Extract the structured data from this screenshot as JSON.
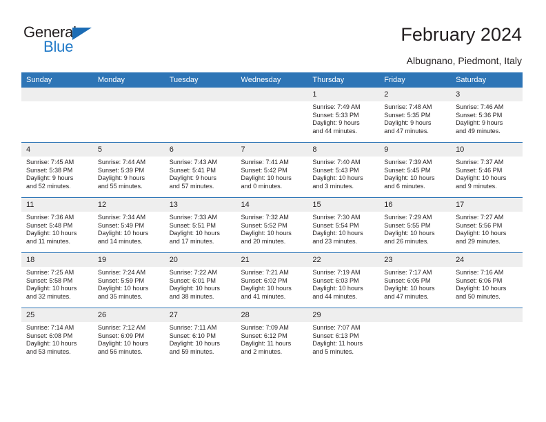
{
  "brand": {
    "name_part1": "General",
    "name_part2": "Blue",
    "accent_color": "#2079c7",
    "triangle_color": "#1b6cb5"
  },
  "header": {
    "title": "February 2024",
    "location": "Albugnano, Piedmont, Italy"
  },
  "theme": {
    "header_bg": "#2e75b6",
    "daynum_bg": "#eeeeee",
    "text_color": "#231f20"
  },
  "weekdays": [
    "Sunday",
    "Monday",
    "Tuesday",
    "Wednesday",
    "Thursday",
    "Friday",
    "Saturday"
  ],
  "labels": {
    "sunrise": "Sunrise:",
    "sunset": "Sunset:",
    "daylight": "Daylight:"
  },
  "weeks": [
    [
      {
        "day": "",
        "sunrise": "",
        "sunset": "",
        "daylight_line1": "",
        "daylight_line2": ""
      },
      {
        "day": "",
        "sunrise": "",
        "sunset": "",
        "daylight_line1": "",
        "daylight_line2": ""
      },
      {
        "day": "",
        "sunrise": "",
        "sunset": "",
        "daylight_line1": "",
        "daylight_line2": ""
      },
      {
        "day": "",
        "sunrise": "",
        "sunset": "",
        "daylight_line1": "",
        "daylight_line2": ""
      },
      {
        "day": "1",
        "sunrise": "Sunrise: 7:49 AM",
        "sunset": "Sunset: 5:33 PM",
        "daylight_line1": "Daylight: 9 hours",
        "daylight_line2": "and 44 minutes."
      },
      {
        "day": "2",
        "sunrise": "Sunrise: 7:48 AM",
        "sunset": "Sunset: 5:35 PM",
        "daylight_line1": "Daylight: 9 hours",
        "daylight_line2": "and 47 minutes."
      },
      {
        "day": "3",
        "sunrise": "Sunrise: 7:46 AM",
        "sunset": "Sunset: 5:36 PM",
        "daylight_line1": "Daylight: 9 hours",
        "daylight_line2": "and 49 minutes."
      }
    ],
    [
      {
        "day": "4",
        "sunrise": "Sunrise: 7:45 AM",
        "sunset": "Sunset: 5:38 PM",
        "daylight_line1": "Daylight: 9 hours",
        "daylight_line2": "and 52 minutes."
      },
      {
        "day": "5",
        "sunrise": "Sunrise: 7:44 AM",
        "sunset": "Sunset: 5:39 PM",
        "daylight_line1": "Daylight: 9 hours",
        "daylight_line2": "and 55 minutes."
      },
      {
        "day": "6",
        "sunrise": "Sunrise: 7:43 AM",
        "sunset": "Sunset: 5:41 PM",
        "daylight_line1": "Daylight: 9 hours",
        "daylight_line2": "and 57 minutes."
      },
      {
        "day": "7",
        "sunrise": "Sunrise: 7:41 AM",
        "sunset": "Sunset: 5:42 PM",
        "daylight_line1": "Daylight: 10 hours",
        "daylight_line2": "and 0 minutes."
      },
      {
        "day": "8",
        "sunrise": "Sunrise: 7:40 AM",
        "sunset": "Sunset: 5:43 PM",
        "daylight_line1": "Daylight: 10 hours",
        "daylight_line2": "and 3 minutes."
      },
      {
        "day": "9",
        "sunrise": "Sunrise: 7:39 AM",
        "sunset": "Sunset: 5:45 PM",
        "daylight_line1": "Daylight: 10 hours",
        "daylight_line2": "and 6 minutes."
      },
      {
        "day": "10",
        "sunrise": "Sunrise: 7:37 AM",
        "sunset": "Sunset: 5:46 PM",
        "daylight_line1": "Daylight: 10 hours",
        "daylight_line2": "and 9 minutes."
      }
    ],
    [
      {
        "day": "11",
        "sunrise": "Sunrise: 7:36 AM",
        "sunset": "Sunset: 5:48 PM",
        "daylight_line1": "Daylight: 10 hours",
        "daylight_line2": "and 11 minutes."
      },
      {
        "day": "12",
        "sunrise": "Sunrise: 7:34 AM",
        "sunset": "Sunset: 5:49 PM",
        "daylight_line1": "Daylight: 10 hours",
        "daylight_line2": "and 14 minutes."
      },
      {
        "day": "13",
        "sunrise": "Sunrise: 7:33 AM",
        "sunset": "Sunset: 5:51 PM",
        "daylight_line1": "Daylight: 10 hours",
        "daylight_line2": "and 17 minutes."
      },
      {
        "day": "14",
        "sunrise": "Sunrise: 7:32 AM",
        "sunset": "Sunset: 5:52 PM",
        "daylight_line1": "Daylight: 10 hours",
        "daylight_line2": "and 20 minutes."
      },
      {
        "day": "15",
        "sunrise": "Sunrise: 7:30 AM",
        "sunset": "Sunset: 5:54 PM",
        "daylight_line1": "Daylight: 10 hours",
        "daylight_line2": "and 23 minutes."
      },
      {
        "day": "16",
        "sunrise": "Sunrise: 7:29 AM",
        "sunset": "Sunset: 5:55 PM",
        "daylight_line1": "Daylight: 10 hours",
        "daylight_line2": "and 26 minutes."
      },
      {
        "day": "17",
        "sunrise": "Sunrise: 7:27 AM",
        "sunset": "Sunset: 5:56 PM",
        "daylight_line1": "Daylight: 10 hours",
        "daylight_line2": "and 29 minutes."
      }
    ],
    [
      {
        "day": "18",
        "sunrise": "Sunrise: 7:25 AM",
        "sunset": "Sunset: 5:58 PM",
        "daylight_line1": "Daylight: 10 hours",
        "daylight_line2": "and 32 minutes."
      },
      {
        "day": "19",
        "sunrise": "Sunrise: 7:24 AM",
        "sunset": "Sunset: 5:59 PM",
        "daylight_line1": "Daylight: 10 hours",
        "daylight_line2": "and 35 minutes."
      },
      {
        "day": "20",
        "sunrise": "Sunrise: 7:22 AM",
        "sunset": "Sunset: 6:01 PM",
        "daylight_line1": "Daylight: 10 hours",
        "daylight_line2": "and 38 minutes."
      },
      {
        "day": "21",
        "sunrise": "Sunrise: 7:21 AM",
        "sunset": "Sunset: 6:02 PM",
        "daylight_line1": "Daylight: 10 hours",
        "daylight_line2": "and 41 minutes."
      },
      {
        "day": "22",
        "sunrise": "Sunrise: 7:19 AM",
        "sunset": "Sunset: 6:03 PM",
        "daylight_line1": "Daylight: 10 hours",
        "daylight_line2": "and 44 minutes."
      },
      {
        "day": "23",
        "sunrise": "Sunrise: 7:17 AM",
        "sunset": "Sunset: 6:05 PM",
        "daylight_line1": "Daylight: 10 hours",
        "daylight_line2": "and 47 minutes."
      },
      {
        "day": "24",
        "sunrise": "Sunrise: 7:16 AM",
        "sunset": "Sunset: 6:06 PM",
        "daylight_line1": "Daylight: 10 hours",
        "daylight_line2": "and 50 minutes."
      }
    ],
    [
      {
        "day": "25",
        "sunrise": "Sunrise: 7:14 AM",
        "sunset": "Sunset: 6:08 PM",
        "daylight_line1": "Daylight: 10 hours",
        "daylight_line2": "and 53 minutes."
      },
      {
        "day": "26",
        "sunrise": "Sunrise: 7:12 AM",
        "sunset": "Sunset: 6:09 PM",
        "daylight_line1": "Daylight: 10 hours",
        "daylight_line2": "and 56 minutes."
      },
      {
        "day": "27",
        "sunrise": "Sunrise: 7:11 AM",
        "sunset": "Sunset: 6:10 PM",
        "daylight_line1": "Daylight: 10 hours",
        "daylight_line2": "and 59 minutes."
      },
      {
        "day": "28",
        "sunrise": "Sunrise: 7:09 AM",
        "sunset": "Sunset: 6:12 PM",
        "daylight_line1": "Daylight: 11 hours",
        "daylight_line2": "and 2 minutes."
      },
      {
        "day": "29",
        "sunrise": "Sunrise: 7:07 AM",
        "sunset": "Sunset: 6:13 PM",
        "daylight_line1": "Daylight: 11 hours",
        "daylight_line2": "and 5 minutes."
      },
      {
        "day": "",
        "sunrise": "",
        "sunset": "",
        "daylight_line1": "",
        "daylight_line2": ""
      },
      {
        "day": "",
        "sunrise": "",
        "sunset": "",
        "daylight_line1": "",
        "daylight_line2": ""
      }
    ]
  ]
}
